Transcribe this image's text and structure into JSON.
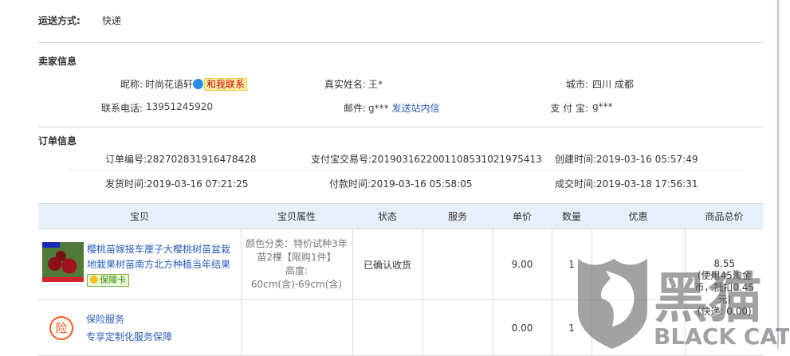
{
  "shipping": {
    "label": "运送方式:",
    "value": "快递"
  },
  "seller": {
    "title": "卖家信息",
    "nickname_label": "昵称:",
    "nickname": "时尚花语轩",
    "contact_button": "和我联系",
    "realname_label": "真实姓名:",
    "realname": "王*",
    "city_label": "城市:",
    "city": "四川 成都",
    "phone_label": "联系电话:",
    "phone": "13951245920",
    "email_label": "邮件:",
    "email": "g***",
    "send_message": "发送站内信",
    "alipay_label": "支 付 宝:",
    "alipay": "g***"
  },
  "order": {
    "title": "订单信息",
    "order_no": "订单编号:282702831916478428",
    "alipay_no": "支付宝交易号:2019031622001108531021975413",
    "created": "创建时间:2019-03-16 05:57:49",
    "shipped": "发货时间:2019-03-16 07:21:25",
    "paid": "付款时间:2019-03-16 05:58:05",
    "completed": "成交时间:2019-03-18 17:56:31"
  },
  "table": {
    "headers": [
      "宝贝",
      "宝贝属性",
      "状态",
      "服务",
      "单价",
      "数量",
      "优惠",
      "商品总价"
    ],
    "rows": [
      {
        "title_line1": "樱桃苗嫁接车厘子大樱桃树苗盆栽",
        "title_line2": "地栽果树苗南方北方种植当年结果",
        "badge": "保障卡",
        "attr1": "颜色分类：特价试种3年",
        "attr2": "苗2棵【限购1件】",
        "attr3": "高度:",
        "attr4": "60cm(含)-69cm(含)",
        "status": "已确认收货",
        "service": "",
        "price": "9.00",
        "qty": "1",
        "discount": "",
        "total": "8.55",
        "total_note1": "(使用45淘金",
        "total_note2": "币，抵扣0.45",
        "total_note3": "元)",
        "shipping_note": "(快递: 0.00)"
      },
      {
        "icon_text": "险",
        "title": "保险服务",
        "subtitle": "专享定制化服务保障",
        "price": "0.00",
        "qty": "1"
      }
    ]
  },
  "watermark": {
    "cn": "黑猫",
    "en": "BLACK CAT"
  }
}
